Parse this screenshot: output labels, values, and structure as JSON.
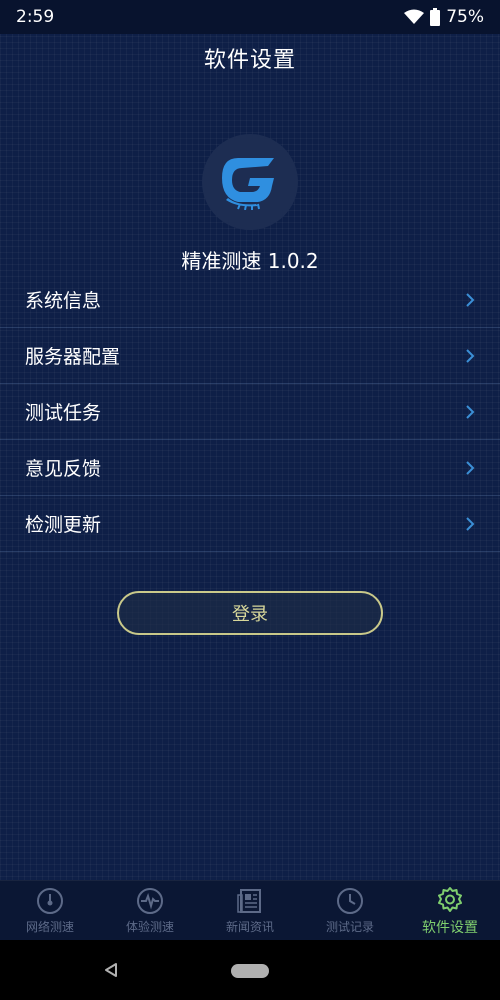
{
  "status_bar": {
    "time": "2:59",
    "battery": "75%",
    "icons": [
      "wifi-icon",
      "battery-icon"
    ]
  },
  "header": {
    "title": "软件设置"
  },
  "app": {
    "logo_letter": "G",
    "name_version": "精准测速 1.0.2"
  },
  "menu": {
    "items": [
      {
        "label": "系统信息"
      },
      {
        "label": "服务器配置"
      },
      {
        "label": "测试任务"
      },
      {
        "label": "意见反馈"
      },
      {
        "label": "检测更新"
      }
    ]
  },
  "login": {
    "label": "登录"
  },
  "tabs": {
    "items": [
      {
        "label": "网络测速",
        "icon": "speed-gauge-icon",
        "active": false
      },
      {
        "label": "体验测速",
        "icon": "pulse-icon",
        "active": false
      },
      {
        "label": "新闻资讯",
        "icon": "newspaper-icon",
        "active": false
      },
      {
        "label": "测试记录",
        "icon": "clock-icon",
        "active": false
      },
      {
        "label": "软件设置",
        "icon": "gear-icon",
        "active": true
      }
    ]
  },
  "colors": {
    "background": "#0e1f47",
    "accent_green": "#7fce6e",
    "chevron_blue": "#3b8fd6",
    "login_border": "#c9c98a"
  }
}
